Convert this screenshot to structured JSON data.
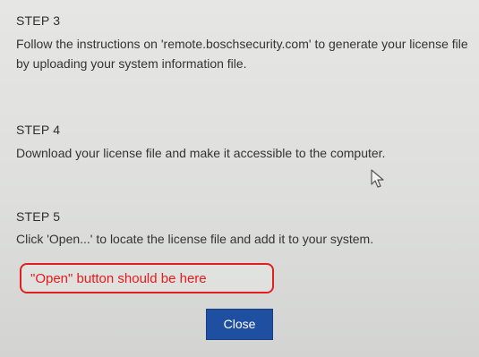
{
  "steps": [
    {
      "title": "STEP 3",
      "text": "Follow the instructions on 'remote.boschsecurity.com' to generate your license file by uploading your system information file."
    },
    {
      "title": "STEP 4",
      "text": "Download your license file and make it accessible to the computer."
    },
    {
      "title": "STEP 5",
      "text": "Click 'Open...' to locate the license file and add it to your system."
    }
  ],
  "annotation": {
    "text": "\"Open\" button should be here",
    "color": "#e02020"
  },
  "buttons": {
    "close_label": "Close",
    "close_color": "#1f4fa0"
  },
  "cursor": {
    "icon": "mouse-pointer-icon"
  }
}
